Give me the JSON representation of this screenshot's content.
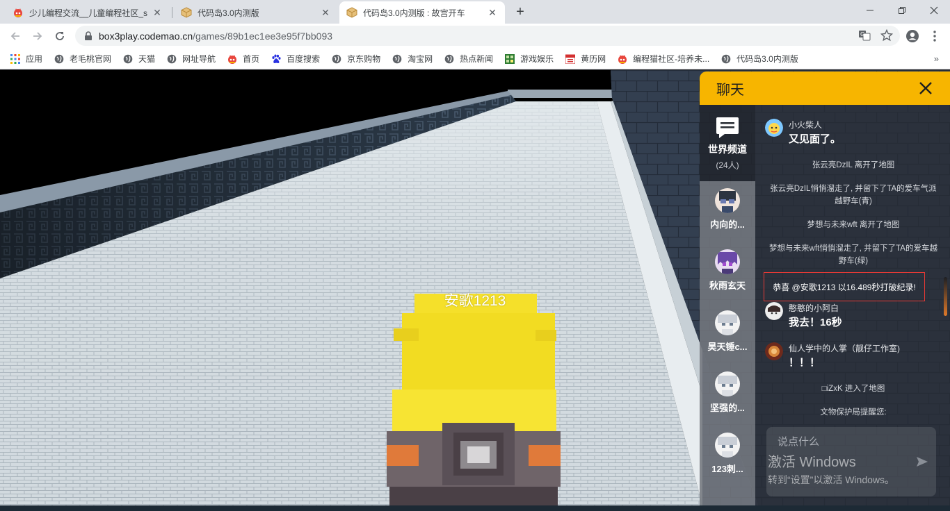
{
  "tabs": [
    {
      "title": "少儿编程交流__儿童编程社区_sc",
      "icon": "codemao-icon"
    },
    {
      "title": "代码岛3.0内测版",
      "icon": "cube-icon"
    },
    {
      "title": "代码岛3.0内测版 : 故宫开车",
      "icon": "cube-icon",
      "active": true
    }
  ],
  "toolbar": {
    "url_host": "box3play.codemao.cn",
    "url_path": "/games/89b1ec1ee3e95f7bb093"
  },
  "bookmarks": [
    {
      "label": "应用",
      "icon": "apps-grid-icon"
    },
    {
      "label": "老毛桃官网",
      "icon": "globe-icon"
    },
    {
      "label": "天猫",
      "icon": "globe-icon"
    },
    {
      "label": "网址导航",
      "icon": "globe-icon"
    },
    {
      "label": "首页",
      "icon": "codemao-icon"
    },
    {
      "label": "百度搜索",
      "icon": "baidu-paw-icon"
    },
    {
      "label": "京东购物",
      "icon": "globe-icon"
    },
    {
      "label": "淘宝网",
      "icon": "globe-icon"
    },
    {
      "label": "热点新闻",
      "icon": "globe-icon"
    },
    {
      "label": "游戏娱乐",
      "icon": "game-icon"
    },
    {
      "label": "黄历网",
      "icon": "calendar-icon"
    },
    {
      "label": "编程猫社区-培养未...",
      "icon": "codemao-icon"
    },
    {
      "label": "代码岛3.0内测版",
      "icon": "globe-icon"
    }
  ],
  "game": {
    "player_name": "安歌1213"
  },
  "chat": {
    "title": "聊天",
    "world_channel": {
      "name": "世界频道",
      "count": "(24人)"
    },
    "dm_list": [
      {
        "name": "内向的..."
      },
      {
        "name": "秋雨玄天"
      },
      {
        "name": "昊天锤c..."
      },
      {
        "name": "坚强的..."
      },
      {
        "name": "123刺..."
      }
    ],
    "messages": {
      "m1_user": "小火柴人",
      "m1_text": "又见面了。",
      "s1": "张云亮DzIL 离开了地图",
      "s2": "张云亮DzIL悄悄溜走了, 并留下了TA的爱车气派越野车(青)",
      "s3": "梦想与未来wft 离开了地图",
      "s4": "梦想与未来wft悄悄溜走了, 并留下了TA的爱车越野车(绿)",
      "record": "恭喜 @安歌1213 以16.489秒打破纪录!",
      "m2_user": "憨憨的小阿白",
      "m2_text": "我去！16秒",
      "m3_user": "仙人学中的人掌（靓仔工作室)",
      "m3_text": "！！！",
      "s5": "□iZxK 进入了地图",
      "s6": "文物保护局提醒您:"
    },
    "input_placeholder": "说点什么",
    "watermark_line1": "激活 Windows",
    "watermark_line2": "转到“设置”以激活 Windows。"
  },
  "colors": {
    "chat_header": "#f7b500",
    "car_yellow": "#f5e02a",
    "record_border": "#e53935"
  }
}
